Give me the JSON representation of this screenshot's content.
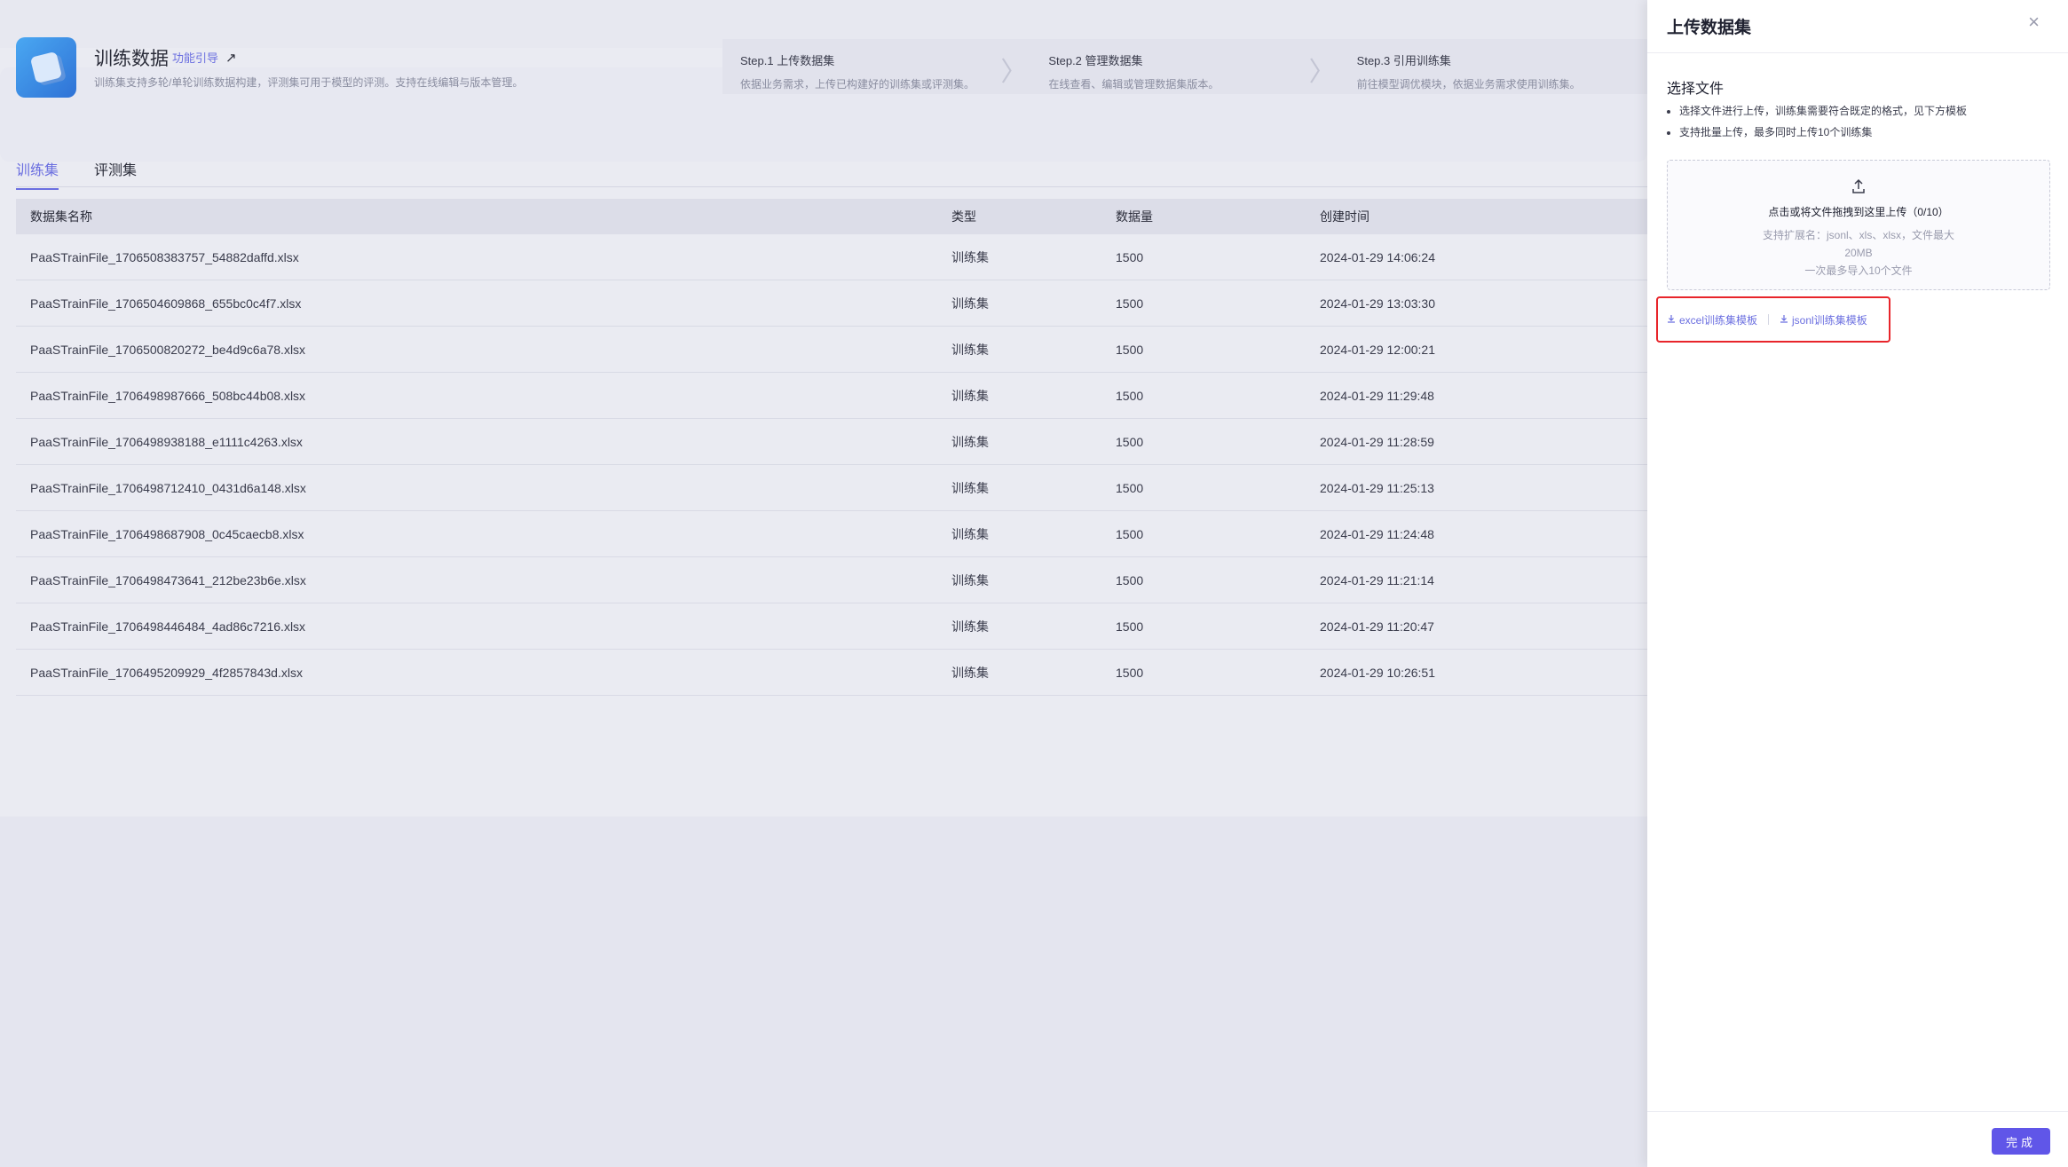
{
  "header": {
    "title": "训练数据",
    "guide_link": "功能引导",
    "description": "训练集支持多轮/单轮训练数据构建，评测集可用于模型的评测。支持在线编辑与版本管理。",
    "steps": [
      {
        "title": "Step.1 上传数据集",
        "desc": "依据业务需求，上传已构建好的训练集或评测集。"
      },
      {
        "title": "Step.2 管理数据集",
        "desc": "在线查看、编辑或管理数据集版本。"
      },
      {
        "title": "Step.3 引用训练集",
        "desc": "前往模型调优模块，依据业务需求使用训练集。"
      }
    ]
  },
  "tabs": [
    "训练集",
    "评测集"
  ],
  "table": {
    "columns": [
      "数据集名称",
      "类型",
      "数据量",
      "创建时间"
    ],
    "rows": [
      [
        "PaaSTrainFile_1706508383757_54882daffd.xlsx",
        "训练集",
        "1500",
        "2024-01-29 14:06:24"
      ],
      [
        "PaaSTrainFile_1706504609868_655bc0c4f7.xlsx",
        "训练集",
        "1500",
        "2024-01-29 13:03:30"
      ],
      [
        "PaaSTrainFile_1706500820272_be4d9c6a78.xlsx",
        "训练集",
        "1500",
        "2024-01-29 12:00:21"
      ],
      [
        "PaaSTrainFile_1706498987666_508bc44b08.xlsx",
        "训练集",
        "1500",
        "2024-01-29 11:29:48"
      ],
      [
        "PaaSTrainFile_1706498938188_e1111c4263.xlsx",
        "训练集",
        "1500",
        "2024-01-29 11:28:59"
      ],
      [
        "PaaSTrainFile_1706498712410_0431d6a148.xlsx",
        "训练集",
        "1500",
        "2024-01-29 11:25:13"
      ],
      [
        "PaaSTrainFile_1706498687908_0c45caecb8.xlsx",
        "训练集",
        "1500",
        "2024-01-29 11:24:48"
      ],
      [
        "PaaSTrainFile_1706498473641_212be23b6e.xlsx",
        "训练集",
        "1500",
        "2024-01-29 11:21:14"
      ],
      [
        "PaaSTrainFile_1706498446484_4ad86c7216.xlsx",
        "训练集",
        "1500",
        "2024-01-29 11:20:47"
      ],
      [
        "PaaSTrainFile_1706495209929_4f2857843d.xlsx",
        "训练集",
        "1500",
        "2024-01-29 10:26:51"
      ]
    ]
  },
  "drawer": {
    "title": "上传数据集",
    "close_icon": "×",
    "section_title": "选择文件",
    "hints": [
      "选择文件进行上传，训练集需要符合既定的格式，见下方模板",
      "支持批量上传，最多同时上传10个训练集"
    ],
    "dropzone": {
      "main": "点击或将文件拖拽到这里上传（0/10）",
      "sub_line1": "支持扩展名：jsonl、xls、xlsx，文件最大",
      "sub_line2": "20MB",
      "sub_line3": "一次最多导入10个文件"
    },
    "templates": [
      "excel训练集模板",
      "jsonl训练集模板"
    ],
    "done_button": "完成"
  },
  "colors": {
    "accent": "#6b6fe0",
    "primary_button": "#6056e8",
    "highlight_border": "#e8252b"
  }
}
